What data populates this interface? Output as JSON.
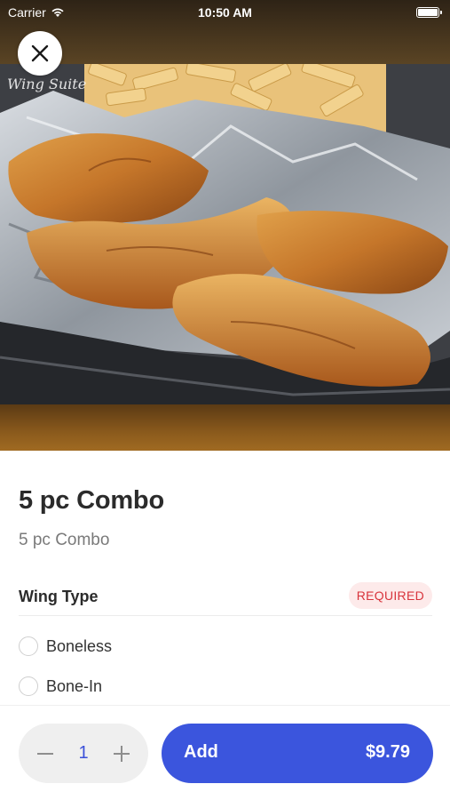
{
  "status_bar": {
    "carrier": "Carrier",
    "time": "10:50 AM",
    "battery_level": 1.0
  },
  "hero": {
    "watermark": "Wing Suite",
    "close_icon": "close-icon"
  },
  "item": {
    "title": "5 pc Combo",
    "subtitle": "5 pc Combo"
  },
  "options": {
    "group_title": "Wing Type",
    "badge": "REQUIRED",
    "badge_color": "#d8343c",
    "choices": [
      {
        "label": "Boneless",
        "selected": false
      },
      {
        "label": "Bone-In",
        "selected": false
      }
    ]
  },
  "footer": {
    "quantity": "1",
    "minus_icon": "minus-icon",
    "plus_icon": "plus-icon",
    "add_label": "Add",
    "price": "$9.79",
    "accent_color": "#3b55dd"
  }
}
